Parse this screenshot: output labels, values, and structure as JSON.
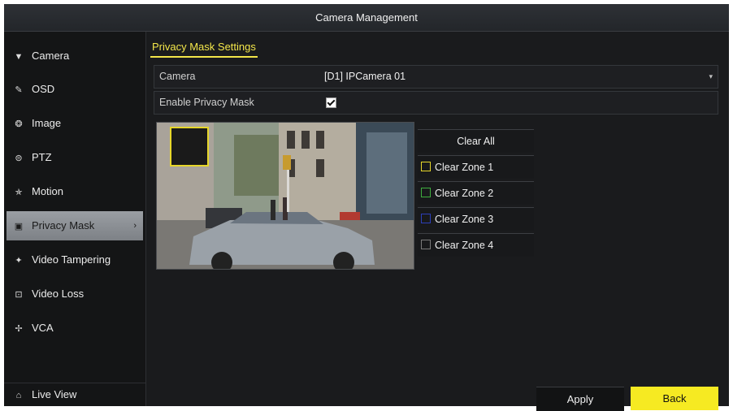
{
  "window": {
    "title": "Camera Management"
  },
  "sidebar": {
    "items": [
      {
        "label": "Camera",
        "icon": "camera-icon",
        "glyph": "▼"
      },
      {
        "label": "OSD",
        "icon": "osd-icon",
        "glyph": "✎"
      },
      {
        "label": "Image",
        "icon": "image-icon",
        "glyph": "❂"
      },
      {
        "label": "PTZ",
        "icon": "ptz-icon",
        "glyph": "⊜"
      },
      {
        "label": "Motion",
        "icon": "motion-icon",
        "glyph": "✯"
      },
      {
        "label": "Privacy Mask",
        "icon": "privacy-mask-icon",
        "glyph": "▣",
        "active": true
      },
      {
        "label": "Video Tampering",
        "icon": "video-tampering-icon",
        "glyph": "✦"
      },
      {
        "label": "Video Loss",
        "icon": "video-loss-icon",
        "glyph": "⊡"
      },
      {
        "label": "VCA",
        "icon": "vca-icon",
        "glyph": "✢"
      }
    ],
    "live_view": {
      "label": "Live View",
      "icon": "home-icon",
      "glyph": "⌂"
    },
    "active_arrow": "›"
  },
  "main": {
    "tab_label": "Privacy Mask Settings",
    "camera": {
      "label": "Camera",
      "value": "[D1] IPCamera 01",
      "caret": "▾"
    },
    "enable": {
      "label": "Enable Privacy Mask",
      "checked": true
    },
    "zones": {
      "clear_all": "Clear All",
      "items": [
        {
          "label": "Clear Zone 1",
          "color": "#e6d62a"
        },
        {
          "label": "Clear Zone 2",
          "color": "#3fae3f"
        },
        {
          "label": "Clear Zone 3",
          "color": "#2d3fb8"
        },
        {
          "label": "Clear Zone 4",
          "color": "#7a7a7a"
        }
      ]
    }
  },
  "buttons": {
    "apply": "Apply",
    "back": "Back"
  },
  "colors": {
    "accent": "#f3e64a",
    "back_button": "#f6ea22"
  }
}
